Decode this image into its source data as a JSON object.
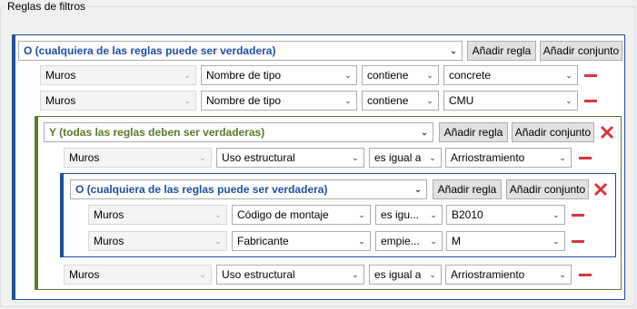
{
  "groupbox": {
    "title": "Reglas de filtros"
  },
  "buttons": {
    "add_rule": "Añadir regla",
    "add_set": "Añadir conjunto"
  },
  "outer_group": {
    "operator": "O (cualquiera de las reglas puede ser verdadera)",
    "rules": [
      {
        "category": "Muros",
        "parameter": "Nombre de tipo",
        "condition": "contiene",
        "value": "concrete"
      },
      {
        "category": "Muros",
        "parameter": "Nombre de tipo",
        "condition": "contiene",
        "value": "CMU"
      }
    ],
    "nested_and": {
      "operator": "Y (todas las reglas deben ser verdaderas)",
      "rules": [
        {
          "category": "Muros",
          "parameter": "Uso estructural",
          "condition": "es igual a",
          "value": "Arriostramiento"
        }
      ],
      "nested_or": {
        "operator": "O (cualquiera de las reglas puede ser verdadera)",
        "rules": [
          {
            "category": "Muros",
            "parameter": "Código de montaje",
            "condition": "es igu...",
            "value": "B2010"
          },
          {
            "category": "Muros",
            "parameter": "Fabricante",
            "condition": "empie...",
            "value": "M"
          }
        ]
      },
      "trailing_rules": [
        {
          "category": "Muros",
          "parameter": "Uso estructural",
          "condition": "es igual a",
          "value": "Arriostramiento"
        }
      ]
    }
  },
  "icons": {
    "dropdown": "chevron-down-icon",
    "remove_rule": "minus-icon",
    "remove_set": "close-x-icon"
  },
  "colors": {
    "or_group": "#1f4e9f",
    "and_group": "#5b7a2a",
    "remove": "#d9363e"
  }
}
